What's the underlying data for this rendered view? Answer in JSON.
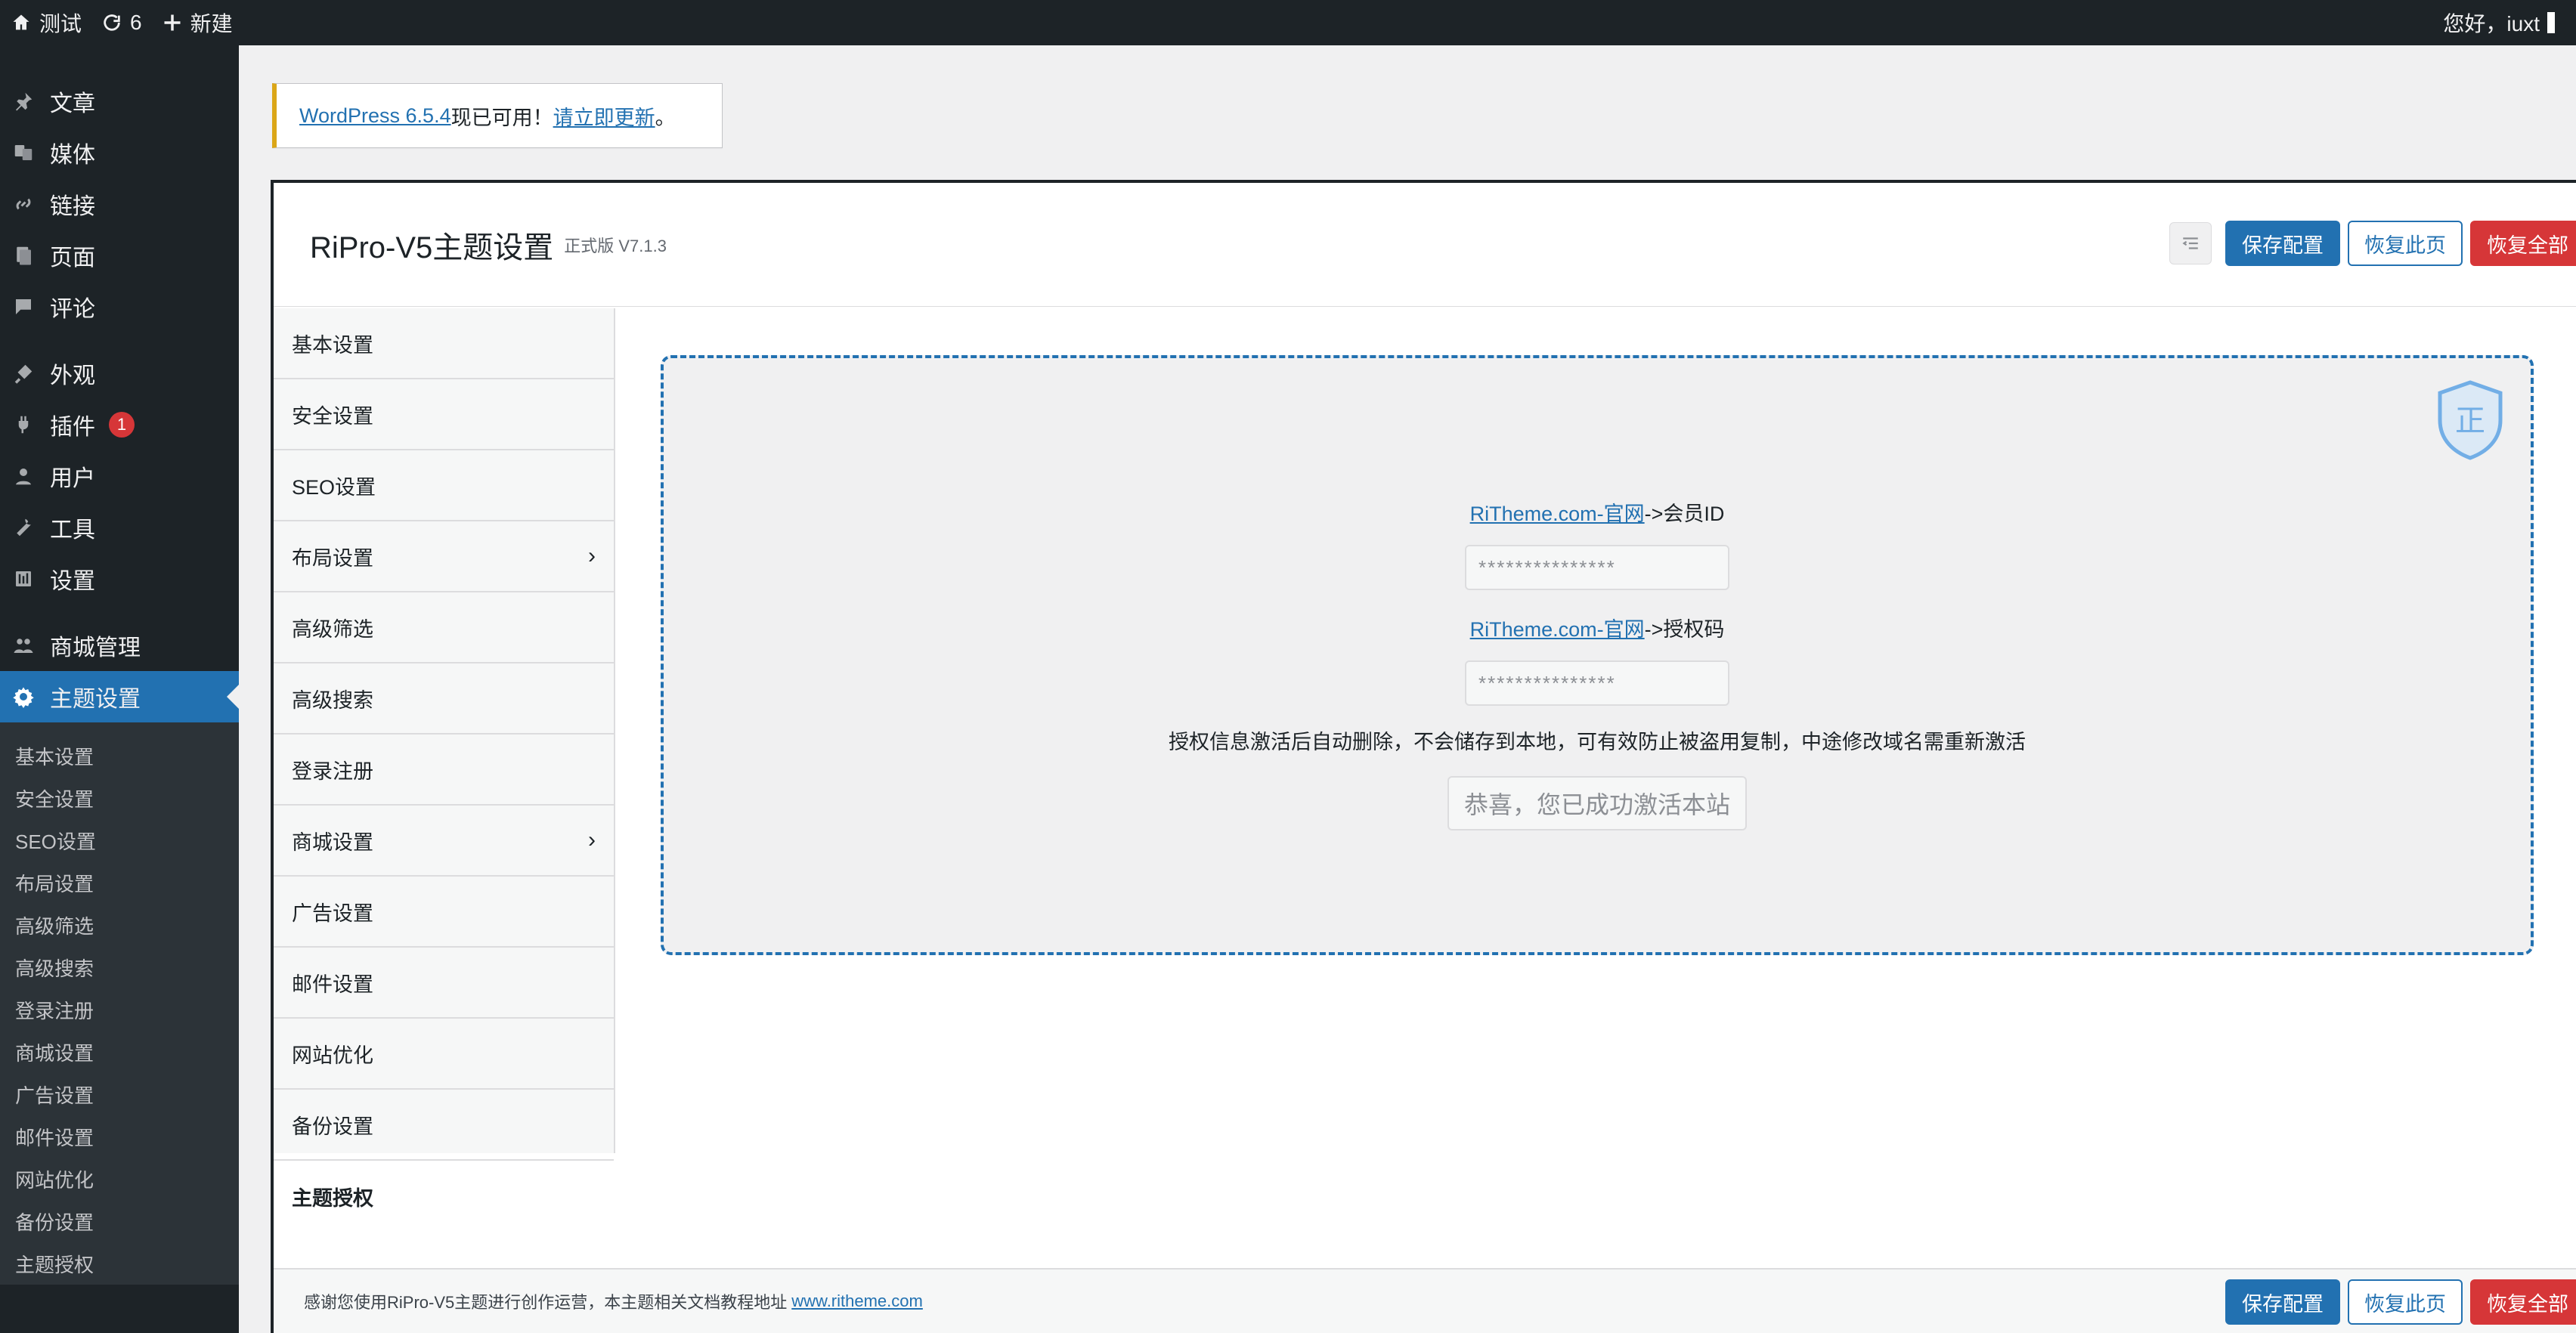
{
  "admin_bar": {
    "site_name": "测试",
    "updates_count": "6",
    "new_label": "新建",
    "greeting": "您好，iuxt"
  },
  "sidebar": {
    "items": [
      {
        "label": "文章",
        "icon": "pin-icon"
      },
      {
        "label": "媒体",
        "icon": "media-icon"
      },
      {
        "label": "链接",
        "icon": "link-icon"
      },
      {
        "label": "页面",
        "icon": "pages-icon"
      },
      {
        "label": "评论",
        "icon": "comments-icon"
      },
      {
        "label": "外观",
        "icon": "appearance-icon"
      },
      {
        "label": "插件",
        "icon": "plugins-icon",
        "badge": "1"
      },
      {
        "label": "用户",
        "icon": "users-icon"
      },
      {
        "label": "工具",
        "icon": "tools-icon"
      },
      {
        "label": "设置",
        "icon": "settings-icon"
      },
      {
        "label": "商城管理",
        "icon": "shop-icon"
      },
      {
        "label": "主题设置",
        "icon": "gear-icon",
        "active": true
      }
    ],
    "submenu": [
      "基本设置",
      "安全设置",
      "SEO设置",
      "布局设置",
      "高级筛选",
      "高级搜索",
      "登录注册",
      "商城设置",
      "广告设置",
      "邮件设置",
      "网站优化",
      "备份设置",
      "主题授权"
    ]
  },
  "notice": {
    "prefix_link": "WordPress 6.5.4",
    "middle": " 现已可用！",
    "action_link": "请立即更新",
    "suffix": "。"
  },
  "panel": {
    "title": "RiPro-V5主题设置",
    "version": "正式版 V7.1.3",
    "buttons": {
      "save": "保存配置",
      "reset_page": "恢复此页",
      "reset_all": "恢复全部"
    },
    "nav": [
      {
        "label": "基本设置"
      },
      {
        "label": "安全设置"
      },
      {
        "label": "SEO设置"
      },
      {
        "label": "布局设置",
        "has_children": true
      },
      {
        "label": "高级筛选"
      },
      {
        "label": "高级搜索"
      },
      {
        "label": "登录注册"
      },
      {
        "label": "商城设置",
        "has_children": true
      },
      {
        "label": "广告设置"
      },
      {
        "label": "邮件设置"
      },
      {
        "label": "网站优化"
      },
      {
        "label": "备份设置"
      },
      {
        "label": "主题授权",
        "active": true
      }
    ],
    "license": {
      "member_link": "RiTheme.com-官网",
      "member_suffix": "->会员ID",
      "member_value": "***************",
      "code_link": "RiTheme.com-官网",
      "code_suffix": "->授权码",
      "code_value": "***************",
      "hint": "授权信息激活后自动删除，不会储存到本地，可有效防止被盗用复制，中途修改域名需重新激活",
      "success": "恭喜，您已成功激活本站",
      "shield_text": "正"
    },
    "footer": {
      "text": "感谢您使用RiPro-V5主题进行创作运营，本主题相关文档教程地址",
      "link": "www.ritheme.com"
    }
  }
}
